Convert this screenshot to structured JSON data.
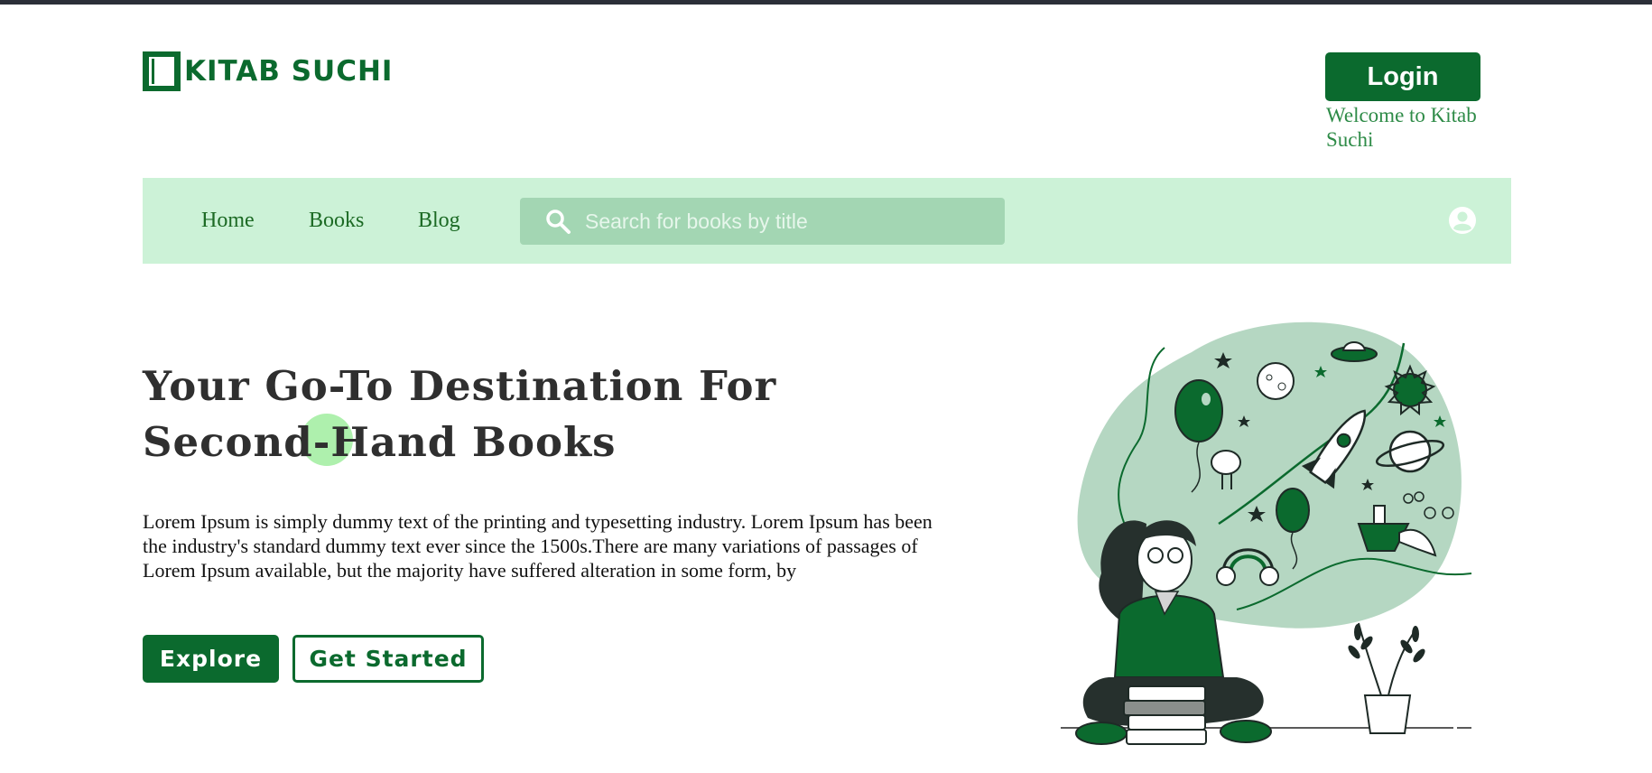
{
  "header": {
    "logo_text": "KITAB SUCHI",
    "logo_icon": "book-icon",
    "login_label": "Login",
    "welcome_text": "Welcome to Kitab Suchi"
  },
  "nav": {
    "links": [
      "Home",
      "Books",
      "Blog"
    ],
    "search_placeholder": "Search for books by title",
    "search_icon": "search-icon",
    "profile_icon": "user-icon"
  },
  "hero": {
    "title": "Your Go-To Destination For Second-Hand Books",
    "description": "Lorem Ipsum is simply dummy text of the printing and typesetting industry. Lorem Ipsum has been the industry's standard dummy text ever since the 1500s.There are many variations of passages of Lorem Ipsum available, but the majority have suffered alteration in some form, by",
    "explore_label": "Explore",
    "get_started_label": "Get Started"
  },
  "colors": {
    "brand_green": "#0b6a2e",
    "nav_background": "#ccf2d7",
    "search_background": "#a3d6b3",
    "illustration_blob": "#b5d7c2",
    "nav_text": "#1c6a24"
  }
}
